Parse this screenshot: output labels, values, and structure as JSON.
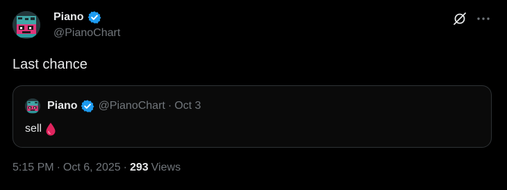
{
  "author": {
    "display_name": "Piano",
    "handle": "@PianoChart",
    "verified_color": "#1d9bf0"
  },
  "tweet": {
    "text": "Last chance"
  },
  "quoted_tweet": {
    "display_name": "Piano",
    "handle": "@PianoChart",
    "separator": "·",
    "date": "Oct 3",
    "text": "sell",
    "emoji_icon": "drop-of-blood-icon"
  },
  "meta": {
    "time": "5:15 PM",
    "separator_1": "·",
    "date": "Oct 6, 2025",
    "separator_2": "·",
    "views_count": "293",
    "views_label": "Views"
  },
  "colors": {
    "background": "#000000",
    "text_primary": "#e7e9ea",
    "text_secondary": "#71767b",
    "border": "#2f3336",
    "accent": "#1d9bf0",
    "drop": "#e0245e"
  }
}
